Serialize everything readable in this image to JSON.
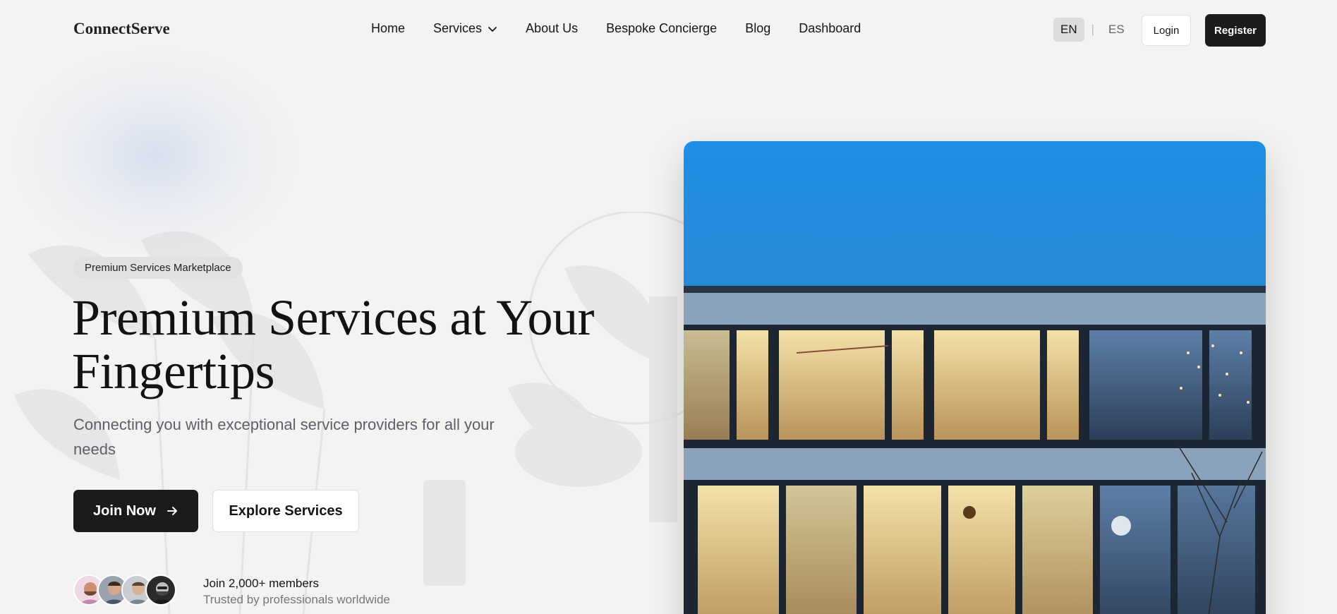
{
  "brand": {
    "logo": "ConnectServe"
  },
  "nav": {
    "items": [
      {
        "label": "Home"
      },
      {
        "label": "Services",
        "has_dropdown": true
      },
      {
        "label": "About Us"
      },
      {
        "label": "Bespoke Concierge"
      },
      {
        "label": "Blog"
      },
      {
        "label": "Dashboard"
      }
    ]
  },
  "language": {
    "options": [
      "EN",
      "ES"
    ],
    "selected": "EN",
    "separator": "|"
  },
  "auth": {
    "login_label": "Login",
    "register_label": "Register"
  },
  "hero": {
    "badge": "Premium Services Marketplace",
    "title": "Premium Services at Your Fingertips",
    "subtitle": "Connecting you with exceptional service providers for all your needs",
    "primary_cta": "Join Now",
    "secondary_cta": "Explore Services",
    "members_title": "Join 2,000+ members",
    "members_subtitle": "Trusted by professionals worldwide",
    "avatar_count": 4,
    "image_subject": "modern-house-at-dusk"
  },
  "icons": {
    "dropdown": "chevron-down-icon",
    "cta_arrow": "arrow-right-icon"
  },
  "colors": {
    "background": "#f3f3f2",
    "primary": "#1b1b1b",
    "text": "#161616",
    "muted": "#5c6068",
    "badge_bg": "#e1e1e1"
  }
}
